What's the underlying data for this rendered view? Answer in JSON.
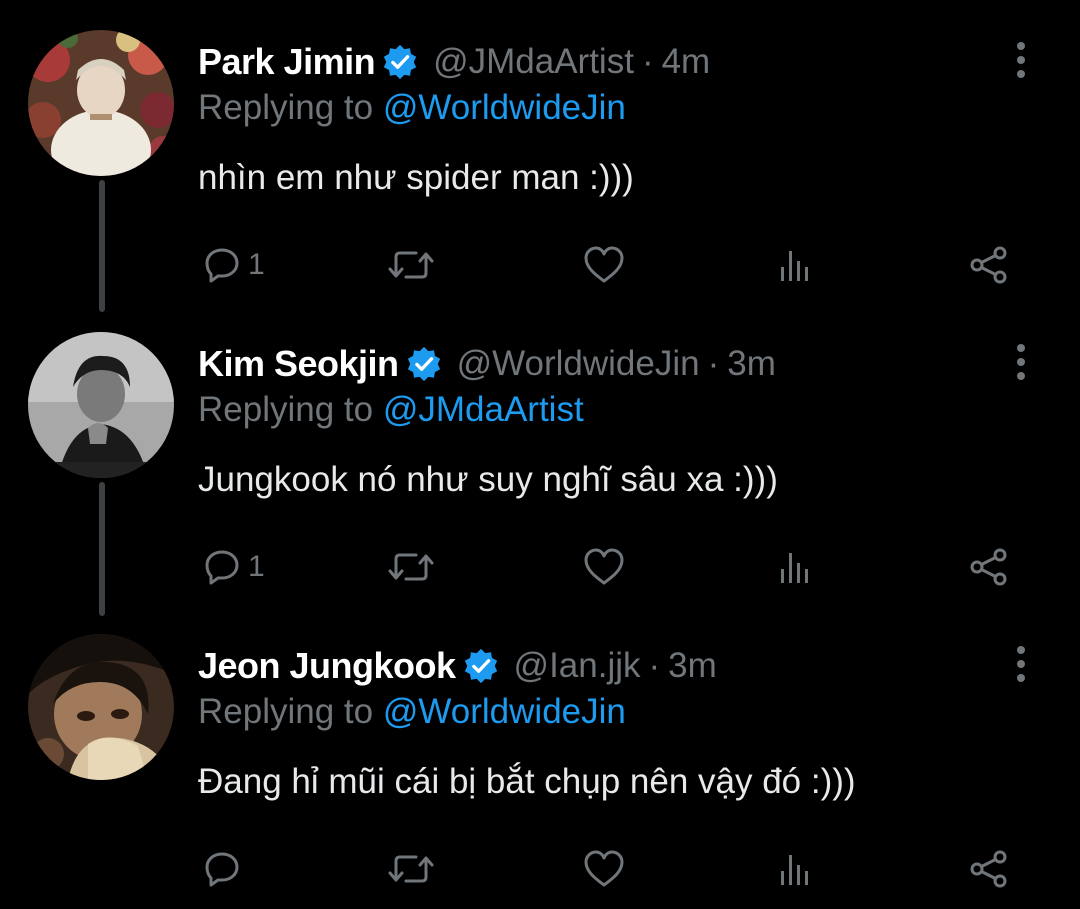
{
  "colors": {
    "background": "#000000",
    "name": "#ffffff",
    "secondary": "#71767b",
    "accent": "#1d9bf0",
    "thread_line": "#3e4144"
  },
  "tweets": [
    {
      "display_name": "Park Jimin",
      "verified": true,
      "handle": "@JMdaArtist",
      "separator": "·",
      "time": "4m",
      "replying_prefix": "Replying to",
      "replying_to": "@WorldwideJin",
      "text": "nhìn em như spider man :)))",
      "reply_count": "1",
      "avatar_icon": "avatar-photo"
    },
    {
      "display_name": "Kim Seokjin",
      "verified": true,
      "handle": "@WorldwideJin",
      "separator": "·",
      "time": "3m",
      "replying_prefix": "Replying to",
      "replying_to": "@JMdaArtist",
      "text": "Jungkook nó như suy nghĩ sâu xa :)))",
      "reply_count": "1",
      "avatar_icon": "avatar-photo"
    },
    {
      "display_name": "Jeon Jungkook",
      "verified": true,
      "handle": "@Ian.jjk",
      "separator": "·",
      "time": "3m",
      "replying_prefix": "Replying to",
      "replying_to": "@WorldwideJin",
      "text": "Đang hỉ mũi cái bị bắt chụp nên vậy đó :)))",
      "reply_count": "",
      "avatar_icon": "avatar-photo"
    }
  ],
  "action_icons": [
    "reply-icon",
    "retweet-icon",
    "like-icon",
    "views-icon",
    "share-icon"
  ]
}
